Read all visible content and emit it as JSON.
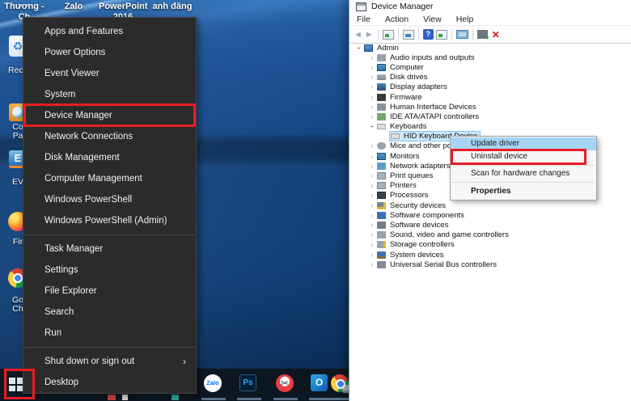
{
  "colors": {
    "red_box": "#ea1c24",
    "hover_blue": "#a5d4f5",
    "selection_blue": "#cde8ff"
  },
  "desktop": {
    "top_labels": [
      {
        "lines": [
          "Thương -",
          "Ch"
        ]
      },
      {
        "lines": [
          "Zalo"
        ]
      },
      {
        "lines": [
          "PowerPoint",
          "2016"
        ]
      },
      {
        "lines": [
          "anh đăng"
        ]
      }
    ],
    "icons": [
      {
        "icon": "recycle-bin-icon",
        "glyph": "♻",
        "lines": [
          "Recy"
        ]
      },
      {
        "icon": "control-panel-icon",
        "glyph": "",
        "lines": [
          "Co",
          "Pa"
        ]
      },
      {
        "icon": "ev-app-icon",
        "glyph": "E",
        "lines": [
          "EV"
        ]
      },
      {
        "icon": "firefox-icon",
        "glyph": "",
        "lines": [
          "Fir"
        ]
      },
      {
        "icon": "chrome-icon",
        "glyph": "",
        "lines": [
          "Go",
          "Ch"
        ]
      }
    ]
  },
  "winx_menu": {
    "items": [
      {
        "label": "Apps and Features"
      },
      {
        "label": "Power Options"
      },
      {
        "label": "Event Viewer"
      },
      {
        "label": "System"
      },
      {
        "label": "Device Manager",
        "red_box": true
      },
      {
        "label": "Network Connections"
      },
      {
        "label": "Disk Management"
      },
      {
        "label": "Computer Management"
      },
      {
        "label": "Windows PowerShell"
      },
      {
        "label": "Windows PowerShell (Admin)"
      },
      {
        "separator": true
      },
      {
        "label": "Task Manager"
      },
      {
        "label": "Settings"
      },
      {
        "label": "File Explorer"
      },
      {
        "label": "Search"
      },
      {
        "label": "Run"
      },
      {
        "separator": true
      },
      {
        "label": "Shut down or sign out",
        "submenu": true
      },
      {
        "label": "Desktop"
      }
    ]
  },
  "device_manager": {
    "window_title": "Device Manager",
    "menu_bar": [
      "File",
      "Action",
      "View",
      "Help"
    ],
    "toolbar_icons": [
      "back-icon",
      "forward-icon",
      "console-tree-icon",
      "export-list-icon",
      "help-icon",
      "action-pane-icon",
      "computer-icon",
      "update-driver-icon",
      "uninstall-icon"
    ],
    "tree": [
      {
        "label": "Admin",
        "level": 0,
        "expanded": true,
        "icon": "computer"
      },
      {
        "label": "Audio inputs and outputs",
        "level": 1,
        "icon": "audio"
      },
      {
        "label": "Computer",
        "level": 1,
        "icon": "monitor"
      },
      {
        "label": "Disk drives",
        "level": 1,
        "icon": "disk"
      },
      {
        "label": "Display adapters",
        "level": 1,
        "icon": "display"
      },
      {
        "label": "Firmware",
        "level": 1,
        "icon": "firmware"
      },
      {
        "label": "Human Interface Devices",
        "level": 1,
        "icon": "hid"
      },
      {
        "label": "IDE ATA/ATAPI controllers",
        "level": 1,
        "icon": "ide"
      },
      {
        "label": "Keyboards",
        "level": 1,
        "expanded": true,
        "icon": "keyboard"
      },
      {
        "label": "HID Keyboard Device",
        "level": 2,
        "leaf": true,
        "icon": "keyboard",
        "selected": true
      },
      {
        "label": "Mice and other pointing devices",
        "level": 1,
        "icon": "mouse"
      },
      {
        "label": "Monitors",
        "level": 1,
        "icon": "monitor"
      },
      {
        "label": "Network adapters",
        "level": 1,
        "icon": "network"
      },
      {
        "label": "Print queues",
        "level": 1,
        "icon": "printer"
      },
      {
        "label": "Printers",
        "level": 1,
        "icon": "printer"
      },
      {
        "label": "Processors",
        "level": 1,
        "icon": "processor"
      },
      {
        "label": "Security devices",
        "level": 1,
        "icon": "security"
      },
      {
        "label": "Software components",
        "level": 1,
        "icon": "swcomp"
      },
      {
        "label": "Software devices",
        "level": 1,
        "icon": "swdev"
      },
      {
        "label": "Sound, video and game controllers",
        "level": 1,
        "icon": "audio"
      },
      {
        "label": "Storage controllers",
        "level": 1,
        "icon": "storage"
      },
      {
        "label": "System devices",
        "level": 1,
        "icon": "system"
      },
      {
        "label": "Universal Serial Bus controllers",
        "level": 1,
        "icon": "usb"
      }
    ],
    "context_menu": {
      "items": [
        {
          "label": "Update driver",
          "hover": true
        },
        {
          "label": "Uninstall device",
          "red_box": true
        },
        {
          "separator": true
        },
        {
          "label": "Scan for hardware changes"
        },
        {
          "separator": true
        },
        {
          "label": "Properties",
          "bold": true
        }
      ]
    }
  },
  "taskbar": {
    "icons": [
      {
        "icon": "zalo-icon",
        "label": "Zalo"
      },
      {
        "icon": "photoshop-icon",
        "label": "Ps"
      },
      {
        "icon": "snip-icon",
        "label": "✂"
      },
      {
        "icon": "outlook-icon",
        "label": "O"
      },
      {
        "icon": "chrome-icon",
        "label": ""
      }
    ]
  }
}
